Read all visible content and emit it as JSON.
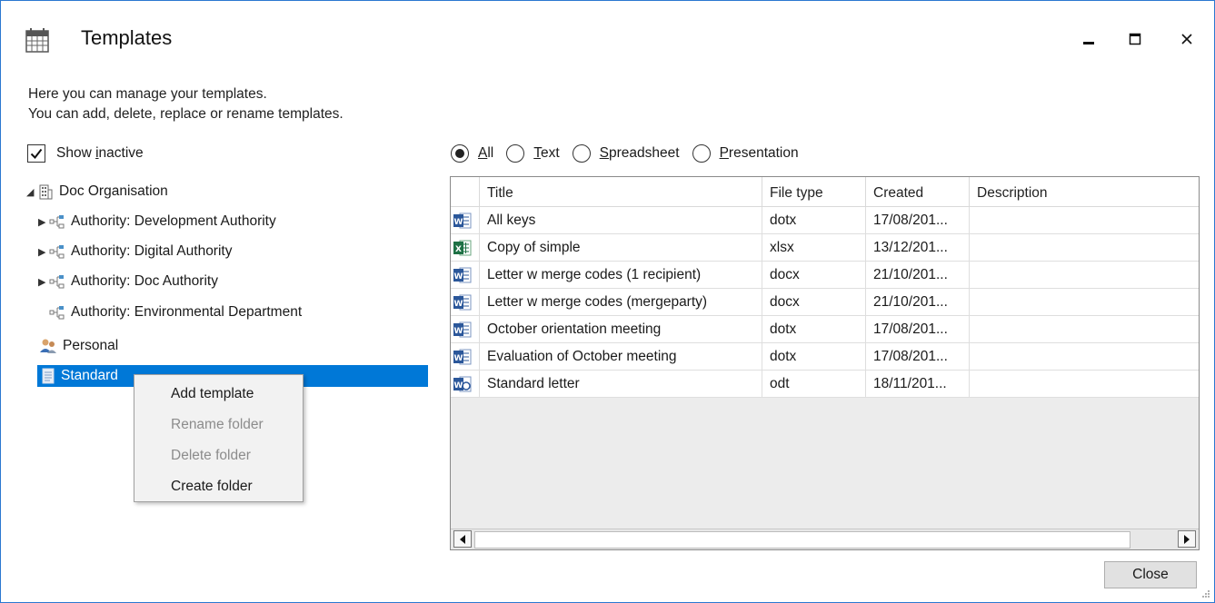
{
  "window": {
    "title": "Templates"
  },
  "intro": {
    "line1": "Here you can manage your templates.",
    "line2": "You can add, delete, replace or rename templates."
  },
  "show_inactive": {
    "label_prefix": "Show ",
    "label_underlined": "i",
    "label_rest": "nactive",
    "checked": true
  },
  "tree": {
    "root": "Doc Organisation",
    "authorities": [
      "Authority: Development Authority",
      "Authority: Digital Authority",
      "Authority: Doc Authority",
      "Authority: Environmental Department"
    ],
    "personal": "Personal",
    "standard": "Standard"
  },
  "context_menu": {
    "add": "Add template",
    "rename": "Rename folder",
    "delete": "Delete folder",
    "create": "Create folder"
  },
  "filters": {
    "all_u": "A",
    "all_rest": "ll",
    "text_u": "T",
    "text_rest": "ext",
    "spreadsheet_u": "S",
    "spreadsheet_rest": "preadsheet",
    "presentation_u": "P",
    "presentation_rest": "resentation",
    "selected": "All"
  },
  "table": {
    "headers": {
      "title": "Title",
      "file_type": "File type",
      "created": "Created",
      "description": "Description"
    },
    "rows": [
      {
        "title": "All keys",
        "file_type": "dotx",
        "created": "17/08/201...",
        "description": "",
        "icon": "word-template-icon"
      },
      {
        "title": "Copy of simple",
        "file_type": "xlsx",
        "created": "13/12/201...",
        "description": "",
        "icon": "excel-icon"
      },
      {
        "title": "Letter w merge codes (1 recipient)",
        "file_type": "docx",
        "created": "21/10/201...",
        "description": "",
        "icon": "word-doc-icon"
      },
      {
        "title": "Letter w merge codes (mergeparty)",
        "file_type": "docx",
        "created": "21/10/201...",
        "description": "",
        "icon": "word-doc-icon"
      },
      {
        "title": "October orientation meeting",
        "file_type": "dotx",
        "created": "17/08/201...",
        "description": "",
        "icon": "word-template-icon"
      },
      {
        "title": "Evaluation of October meeting",
        "file_type": "dotx",
        "created": "17/08/201...",
        "description": "",
        "icon": "word-template-icon"
      },
      {
        "title": "Standard letter",
        "file_type": "odt",
        "created": "18/11/201...",
        "description": "",
        "icon": "odt-icon"
      }
    ]
  },
  "close_button": "Close",
  "colors": {
    "selection": "#0078d7",
    "window_border": "#2b78d0",
    "excel": "#1e7145",
    "word": "#2b579a"
  }
}
